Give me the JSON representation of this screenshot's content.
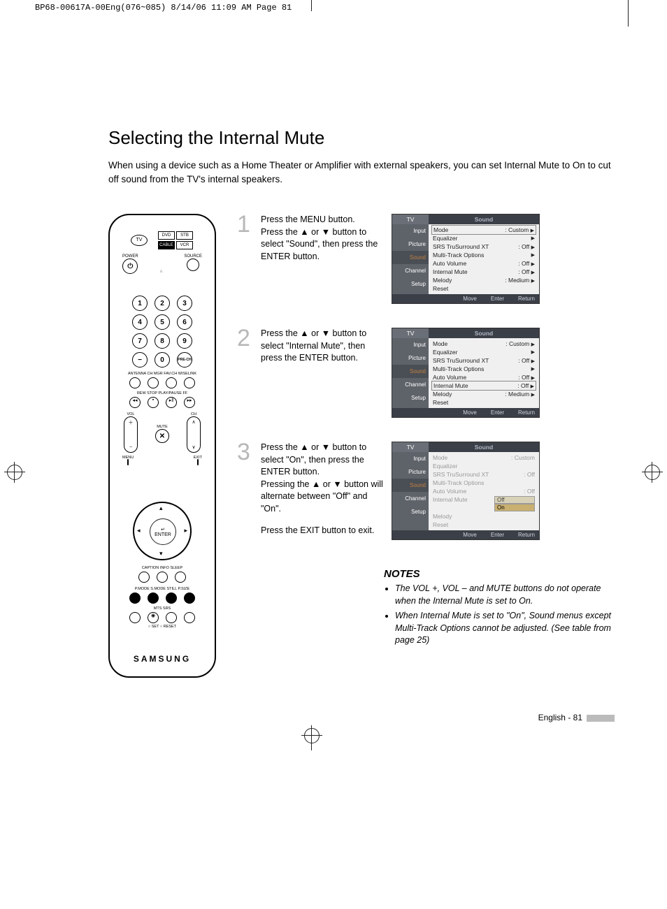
{
  "print_header": "BP68-00617A-00Eng(076~085)  8/14/06  11:09 AM  Page 81",
  "title": "Selecting the Internal Mute",
  "intro": "When using a device such as a Home Theater or Amplifier with external speakers, you can set Internal Mute to On to cut off sound from the TV's internal speakers.",
  "remote": {
    "tv": "TV",
    "sources": [
      "DVD",
      "STB",
      "CABLE",
      "VCR"
    ],
    "power": "POWER",
    "source": "SOURCE",
    "numbers": [
      "1",
      "2",
      "3",
      "4",
      "5",
      "6",
      "7",
      "8",
      "9",
      "−",
      "0",
      "PRE-CH"
    ],
    "row_labels1": "ANTENNA CH MGR  FAV.CH  WISELINK",
    "row_labels2": "REW   STOP  PLAY/PAUSE  FF",
    "vol": "VOL",
    "ch": "CH",
    "mute": "MUTE",
    "menu": "MENU",
    "exit": "EXIT",
    "enter": "ENTER",
    "row_labels3": "CAPTION   INFO    SLEEP",
    "row_labels4": "P.MODE  S.MODE  STILL  P.SIZE",
    "row_labels5": "MTS    SRS",
    "setreset": "○ SET   ○ RESET",
    "brand": "SAMSUNG"
  },
  "steps": [
    {
      "num": "1",
      "text": "Press the MENU button.\nPress the ▲ or ▼ button to select \"Sound\", then press the ENTER button."
    },
    {
      "num": "2",
      "text": "Press the ▲ or ▼ button to select \"Internal Mute\", then press the ENTER button."
    },
    {
      "num": "3",
      "text": "Press the ▲ or ▼ button to select \"On\", then press the ENTER button.\nPressing the ▲ or ▼ button will alternate between \"Off\" and \"On\".",
      "extra": "Press the EXIT button to exit."
    }
  ],
  "osd": {
    "tv_label": "TV",
    "title": "Sound",
    "tabs": [
      "Input",
      "Picture",
      "Sound",
      "Channel",
      "Setup"
    ],
    "items": [
      {
        "label": "Mode",
        "value": ": Custom",
        "arrow": true
      },
      {
        "label": "Equalizer",
        "value": "",
        "arrow": true
      },
      {
        "label": "SRS TruSurround XT",
        "value": ": Off",
        "arrow": true
      },
      {
        "label": "Multi-Track Options",
        "value": "",
        "arrow": true
      },
      {
        "label": "Auto Volume",
        "value": ": Off",
        "arrow": true
      },
      {
        "label": "Internal Mute",
        "value": ": Off",
        "arrow": true
      },
      {
        "label": "Melody",
        "value": ": Medium",
        "arrow": true
      },
      {
        "label": "Reset",
        "value": "",
        "arrow": false
      }
    ],
    "sub_options": [
      "Off",
      "On"
    ],
    "footer": [
      "Move",
      "Enter",
      "Return"
    ]
  },
  "notes_heading": "NOTES",
  "notes": [
    "The VOL +, VOL – and MUTE buttons do not operate when the Internal Mute is set to On.",
    "When Internal Mute is set to \"On\", Sound menus except Multi-Track Options cannot be adjusted. (See table from page 25)"
  ],
  "footer": "English - 81"
}
